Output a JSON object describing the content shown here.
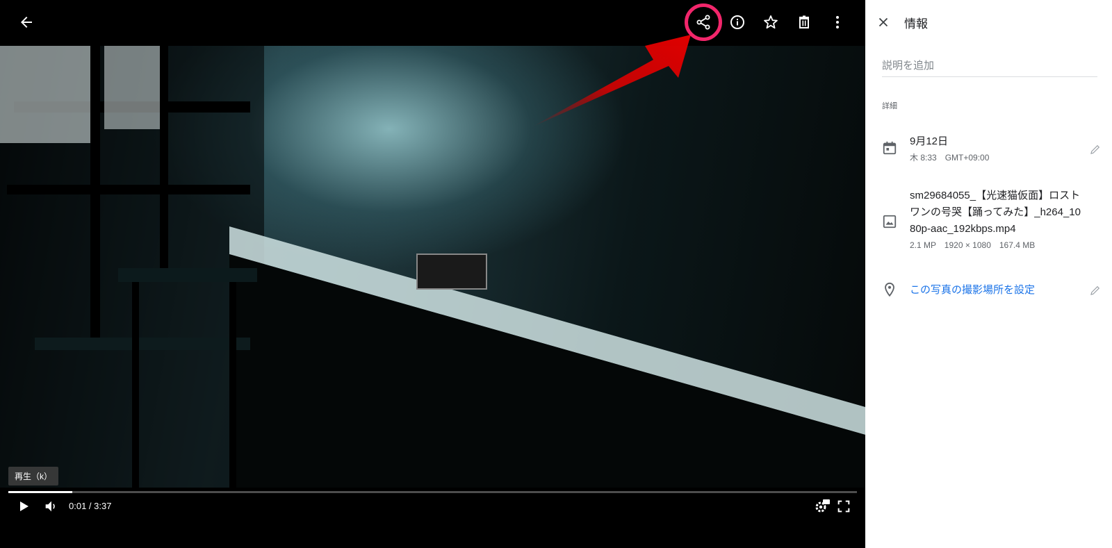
{
  "viewer": {
    "tooltip": "再生（k）",
    "time": "0:01 / 3:37",
    "progress_fraction": 0.075
  },
  "icons": {
    "back": "arrow-back-icon",
    "share": "share-icon",
    "info": "info-icon",
    "favorite": "star-outline-icon",
    "delete": "trash-icon",
    "more": "more-vert-icon",
    "play": "play-icon",
    "volume": "volume-icon",
    "quality": "settings-hd-icon",
    "fullscreen": "fullscreen-icon"
  },
  "annotation": {
    "color": "#f2266b",
    "arrow_color": "#e00000"
  },
  "panel": {
    "title": "情報",
    "description_placeholder": "説明を追加",
    "details_label": "詳細",
    "date": {
      "primary": "9月12日",
      "secondary": "木 8:33　GMT+09:00"
    },
    "file": {
      "name": "sm29684055_【光速猫仮面】ロストワンの号哭【踊ってみた】_h264_1080p-aac_192kbps.mp4",
      "meta": "2.1 MP　1920 × 1080　167.4 MB"
    },
    "location_link": "この写真の撮影場所を設定",
    "link_color": "#1a73e8"
  }
}
